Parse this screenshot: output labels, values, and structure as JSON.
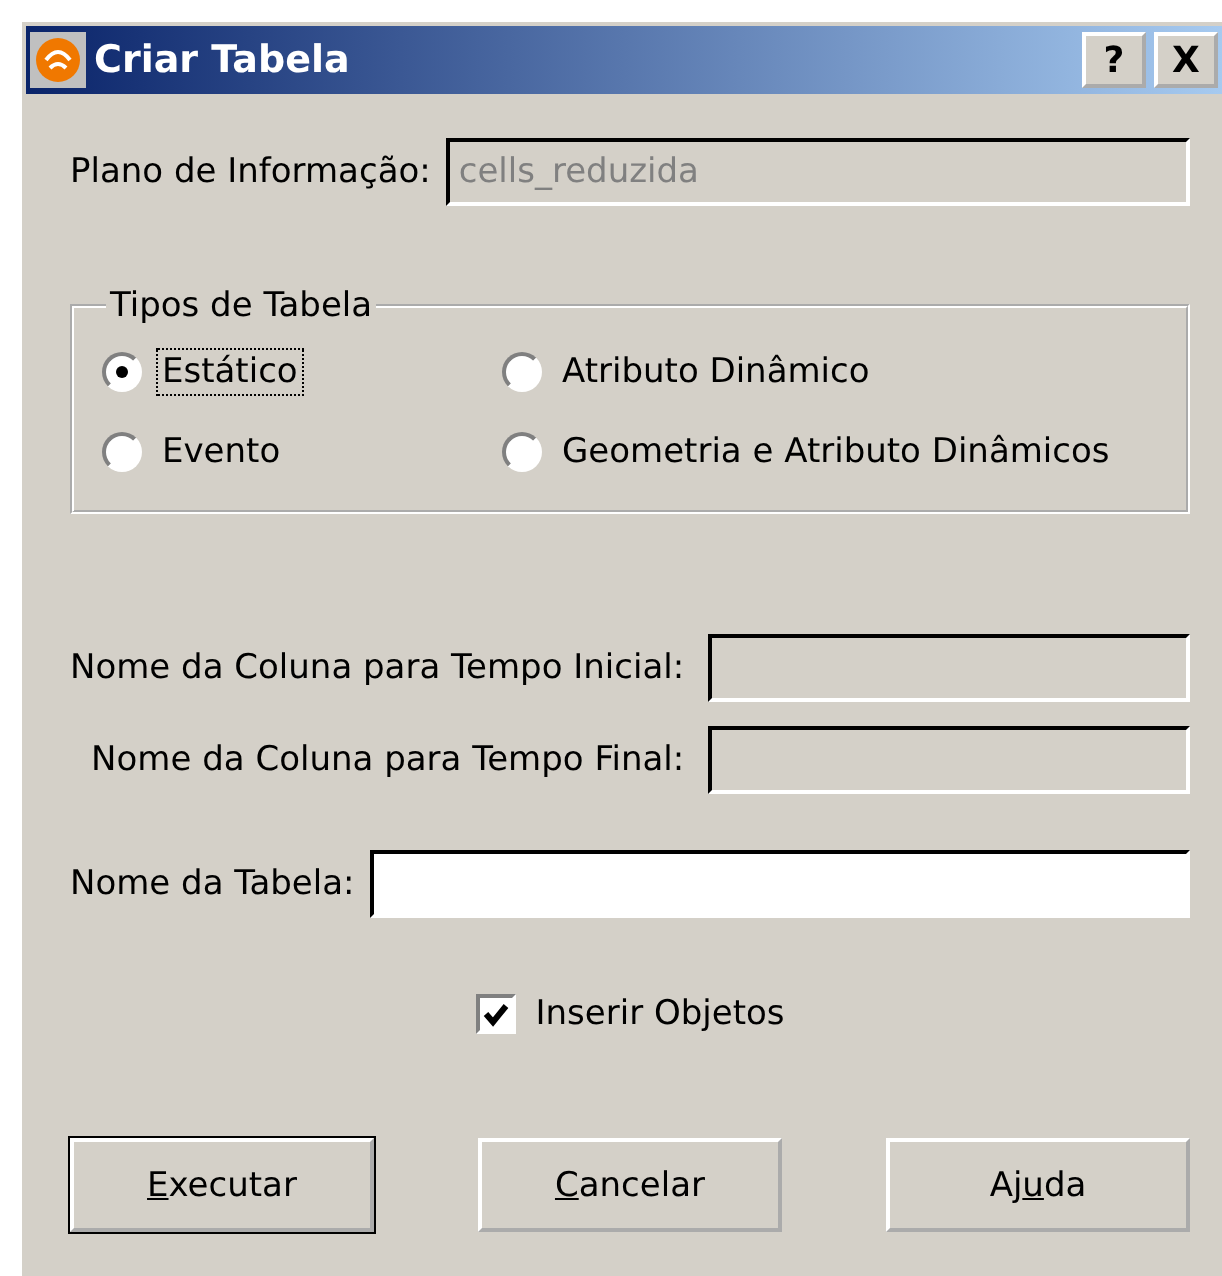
{
  "window": {
    "title": "Criar Tabela",
    "title_buttons": [
      "?",
      "X"
    ]
  },
  "info_plane": {
    "label": "Plano de Informação:",
    "value": "cells_reduzida",
    "disabled": true
  },
  "table_types": {
    "legend": "Tipos de Tabela",
    "options": [
      {
        "label": "Estático",
        "selected": true,
        "focused": true
      },
      {
        "label": "Atributo Dinâmico",
        "selected": false,
        "focused": false
      },
      {
        "label": "Evento",
        "selected": false,
        "focused": false
      },
      {
        "label": "Geometria e Atributo Dinâmicos",
        "selected": false,
        "focused": false
      }
    ]
  },
  "time_fields": [
    {
      "label": "Nome da Coluna para Tempo Inicial:",
      "disabled": true
    },
    {
      "label": "Nome da Coluna para Tempo Final:",
      "disabled": true
    }
  ],
  "table_name": {
    "label": "Nome da Tabela:",
    "disabled": false
  },
  "insert_objects": {
    "label": "Inserir Objetos",
    "checked": true
  },
  "buttons": [
    {
      "key": "E",
      "post": "xecutar",
      "default": true
    },
    {
      "key": "C",
      "post": "ancelar",
      "default": false
    },
    {
      "pre": "Aj",
      "key": "u",
      "post": "da",
      "default": false
    }
  ]
}
